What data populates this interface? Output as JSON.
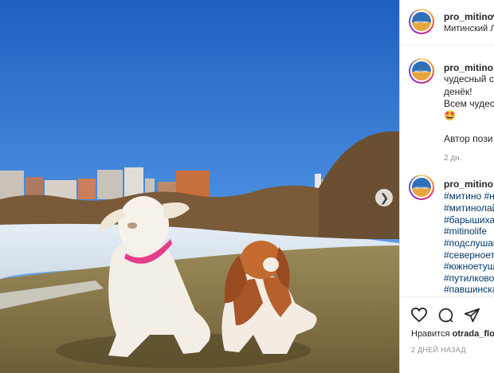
{
  "post": {
    "username": "pro_mitino",
    "location": "Митинский Ла",
    "avatar_text": "МИТИНО",
    "caption_lines": [
      "чудесный со",
      "денёк!",
      "Всем чудесн"
    ],
    "emoji": "🤩",
    "author_line": "Автор пози",
    "caption_age": "2 дн.",
    "tags_username": "pro_mitino",
    "tags": [
      "#митино #н",
      "#митинолай",
      "#барышиха",
      "#mitinolife",
      "#подслушан",
      "#северноет",
      "#южноетуш",
      "#путилково",
      "#павшинска"
    ],
    "liked_by_prefix": "Нравится",
    "liked_by_user": "otrada_flo",
    "posted_ago": "2 ДНЕЙ НАЗАД"
  },
  "icons": {
    "next": "chevron-right-icon",
    "like": "heart-icon",
    "comment": "comment-icon",
    "share": "send-icon"
  },
  "colors": {
    "link": "#00376b",
    "muted": "#8e8e8e",
    "text": "#262626",
    "sky": "#2f6fc7"
  }
}
